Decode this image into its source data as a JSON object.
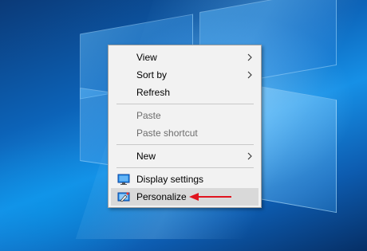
{
  "menu": {
    "items": [
      {
        "label": "View",
        "icon": "",
        "submenu": true,
        "disabled": false
      },
      {
        "label": "Sort by",
        "icon": "",
        "submenu": true,
        "disabled": false
      },
      {
        "label": "Refresh",
        "icon": "",
        "submenu": false,
        "disabled": false
      },
      {
        "label": "Paste",
        "icon": "",
        "submenu": false,
        "disabled": true
      },
      {
        "label": "Paste shortcut",
        "icon": "",
        "submenu": false,
        "disabled": true
      },
      {
        "label": "New",
        "icon": "",
        "submenu": true,
        "disabled": false
      },
      {
        "label": "Display settings",
        "icon": "display-settings-icon",
        "submenu": false,
        "disabled": false
      },
      {
        "label": "Personalize",
        "icon": "personalize-icon",
        "submenu": false,
        "disabled": false,
        "highlighted": true
      }
    ]
  },
  "annotation": {
    "arrow_color": "#e0141e",
    "points_to": "Personalize"
  },
  "colors": {
    "menu_background": "#f2f2f2",
    "highlight": "#d9d9d9",
    "disabled_text": "#6d6d6d",
    "desktop_blue": "#0c63b8"
  }
}
